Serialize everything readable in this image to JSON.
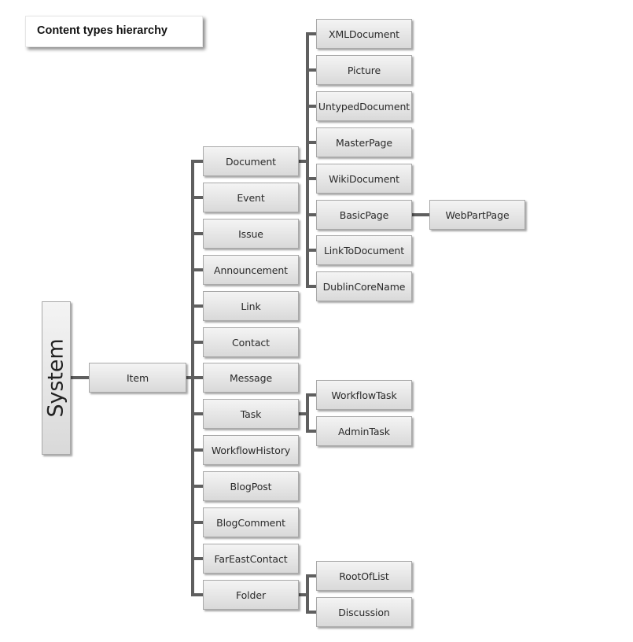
{
  "title": "Content types hierarchy",
  "root": "System",
  "tree": {
    "label": "Item",
    "children": [
      {
        "label": "Document",
        "children": [
          {
            "label": "XMLDocument"
          },
          {
            "label": "Picture"
          },
          {
            "label": "UntypedDocument"
          },
          {
            "label": "MasterPage"
          },
          {
            "label": "WikiDocument"
          },
          {
            "label": "BasicPage",
            "children": [
              {
                "label": "WebPartPage"
              }
            ]
          },
          {
            "label": "LinkToDocument"
          },
          {
            "label": "DublinCoreName"
          }
        ]
      },
      {
        "label": "Event"
      },
      {
        "label": "Issue"
      },
      {
        "label": "Announcement"
      },
      {
        "label": "Link"
      },
      {
        "label": "Contact"
      },
      {
        "label": "Message"
      },
      {
        "label": "Task",
        "children": [
          {
            "label": "WorkflowTask"
          },
          {
            "label": "AdminTask"
          }
        ]
      },
      {
        "label": "WorkflowHistory"
      },
      {
        "label": "BlogPost"
      },
      {
        "label": "BlogComment"
      },
      {
        "label": "FarEastContact"
      },
      {
        "label": "Folder",
        "children": [
          {
            "label": "RootOfList"
          },
          {
            "label": "Discussion"
          }
        ]
      }
    ]
  }
}
